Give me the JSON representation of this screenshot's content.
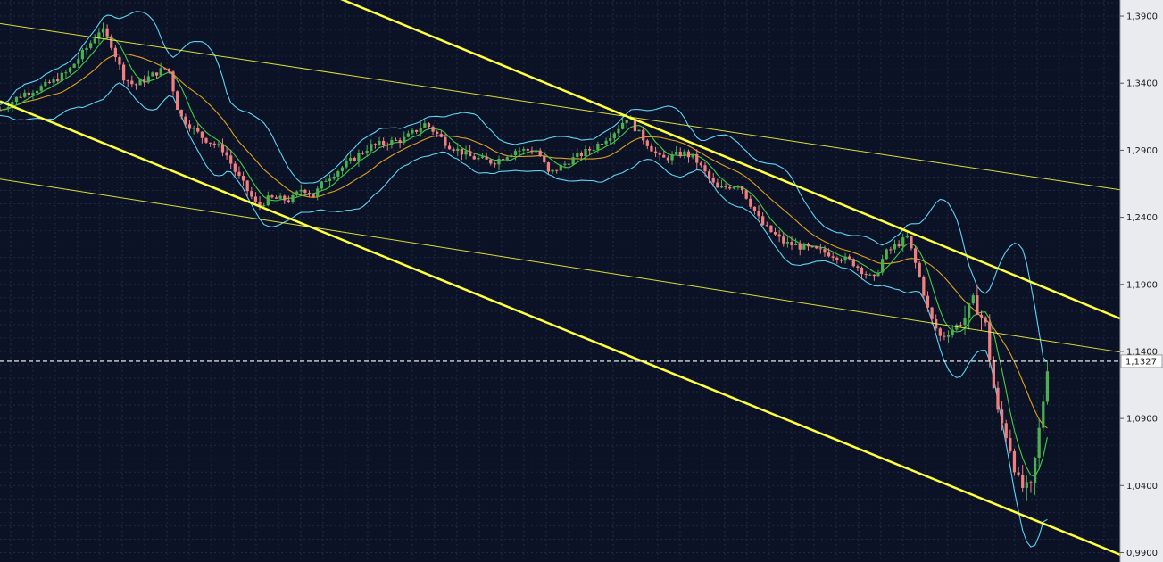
{
  "chart_data": {
    "type": "candlestick",
    "y_axis": {
      "ticks": [
        "1,3900",
        "1,3400",
        "1,2900",
        "1,2400",
        "1,1900",
        "1,1400",
        "1,0900",
        "1,0400",
        "0,9900"
      ],
      "tick_values": [
        1.39,
        1.34,
        1.29,
        1.24,
        1.19,
        1.14,
        1.09,
        1.04,
        0.99
      ],
      "range": [
        0.983,
        1.402
      ],
      "position": "right"
    },
    "current_price": {
      "label": "1,1327",
      "value": 1.1327
    },
    "grid": true,
    "indicators": [
      "bollinger-bands",
      "fast-ma",
      "slow-ma"
    ],
    "colors": {
      "background": "#0b1226",
      "grid": "#2a3350",
      "axis_panel": "#e9ebef",
      "bull": "#4caf50",
      "bear": "#f08080",
      "bollinger": "#5fd4f0",
      "fast_ma": "#44cc44",
      "slow_ma": "#e0a020",
      "trendline": "#ffff3c",
      "price_line": "#ffffff"
    },
    "trendlines": [
      {
        "name": "upper-channel-top",
        "style": "thin",
        "from": {
          "x": 0,
          "y": 1.3845
        },
        "to": {
          "x": 1,
          "y": 1.2605
        }
      },
      {
        "name": "upper-channel-bottom",
        "style": "thin",
        "from": {
          "x": 0,
          "y": 1.2685
        },
        "to": {
          "x": 1,
          "y": 1.1395
        }
      },
      {
        "name": "steep-channel-top",
        "style": "thick",
        "from": {
          "x": 0.302,
          "y": 1.4035
        },
        "to": {
          "x": 1,
          "y": 1.1645
        }
      },
      {
        "name": "steep-channel-bottom",
        "style": "thick",
        "from": {
          "x": 0,
          "y": 1.3265
        },
        "to": {
          "x": 1,
          "y": 0.9885
        }
      }
    ],
    "price_series": [
      [
        0.0,
        1.32
      ],
      [
        0.02,
        1.332
      ],
      [
        0.04,
        1.338
      ],
      [
        0.06,
        1.348
      ],
      [
        0.08,
        1.369
      ],
      [
        0.09,
        1.381
      ],
      [
        0.1,
        1.368
      ],
      [
        0.11,
        1.345
      ],
      [
        0.12,
        1.338
      ],
      [
        0.14,
        1.348
      ],
      [
        0.15,
        1.352
      ],
      [
        0.16,
        1.316
      ],
      [
        0.18,
        1.3
      ],
      [
        0.2,
        1.29
      ],
      [
        0.21,
        1.274
      ],
      [
        0.23,
        1.248
      ],
      [
        0.24,
        1.254
      ],
      [
        0.26,
        1.253
      ],
      [
        0.27,
        1.262
      ],
      [
        0.28,
        1.256
      ],
      [
        0.29,
        1.268
      ],
      [
        0.31,
        1.28
      ],
      [
        0.33,
        1.293
      ],
      [
        0.36,
        1.298
      ],
      [
        0.38,
        1.31
      ],
      [
        0.4,
        1.294
      ],
      [
        0.42,
        1.285
      ],
      [
        0.44,
        1.281
      ],
      [
        0.46,
        1.29
      ],
      [
        0.48,
        1.29
      ],
      [
        0.49,
        1.272
      ],
      [
        0.51,
        1.283
      ],
      [
        0.53,
        1.292
      ],
      [
        0.55,
        1.305
      ],
      [
        0.56,
        1.315
      ],
      [
        0.57,
        1.303
      ],
      [
        0.59,
        1.283
      ],
      [
        0.61,
        1.288
      ],
      [
        0.62,
        1.284
      ],
      [
        0.64,
        1.261
      ],
      [
        0.66,
        1.265
      ],
      [
        0.68,
        1.235
      ],
      [
        0.7,
        1.221
      ],
      [
        0.72,
        1.217
      ],
      [
        0.74,
        1.213
      ],
      [
        0.76,
        1.207
      ],
      [
        0.78,
        1.193
      ],
      [
        0.79,
        1.213
      ],
      [
        0.81,
        1.225
      ],
      [
        0.82,
        1.198
      ],
      [
        0.83,
        1.166
      ],
      [
        0.84,
        1.15
      ],
      [
        0.86,
        1.163
      ],
      [
        0.87,
        1.178
      ],
      [
        0.88,
        1.158
      ],
      [
        0.89,
        1.095
      ],
      [
        0.9,
        1.075
      ],
      [
        0.91,
        1.04
      ],
      [
        0.92,
        1.035
      ],
      [
        0.93,
        1.095
      ],
      [
        0.935,
        1.13
      ]
    ]
  }
}
